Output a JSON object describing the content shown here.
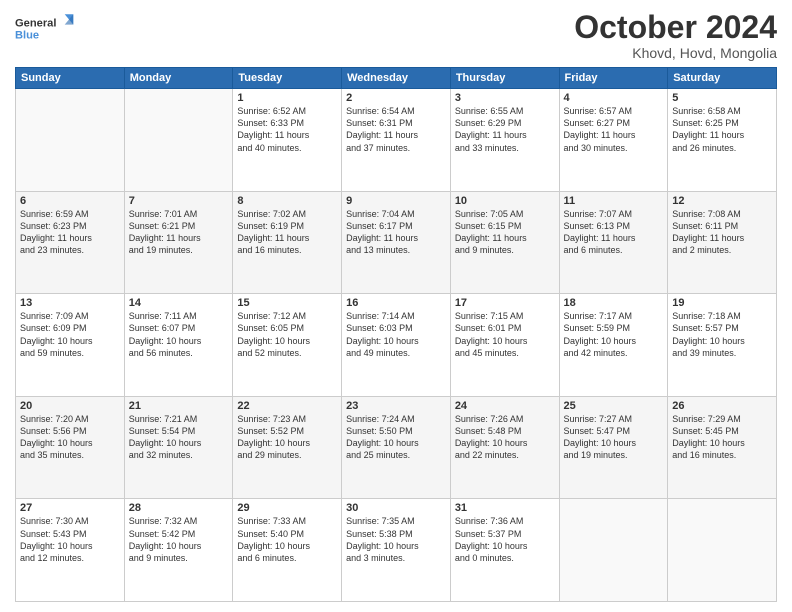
{
  "logo": {
    "line1": "General",
    "line2": "Blue"
  },
  "title": "October 2024",
  "location": "Khovd, Hovd, Mongolia",
  "weekdays": [
    "Sunday",
    "Monday",
    "Tuesday",
    "Wednesday",
    "Thursday",
    "Friday",
    "Saturday"
  ],
  "weeks": [
    [
      {
        "day": "",
        "info": ""
      },
      {
        "day": "",
        "info": ""
      },
      {
        "day": "1",
        "info": "Sunrise: 6:52 AM\nSunset: 6:33 PM\nDaylight: 11 hours\nand 40 minutes."
      },
      {
        "day": "2",
        "info": "Sunrise: 6:54 AM\nSunset: 6:31 PM\nDaylight: 11 hours\nand 37 minutes."
      },
      {
        "day": "3",
        "info": "Sunrise: 6:55 AM\nSunset: 6:29 PM\nDaylight: 11 hours\nand 33 minutes."
      },
      {
        "day": "4",
        "info": "Sunrise: 6:57 AM\nSunset: 6:27 PM\nDaylight: 11 hours\nand 30 minutes."
      },
      {
        "day": "5",
        "info": "Sunrise: 6:58 AM\nSunset: 6:25 PM\nDaylight: 11 hours\nand 26 minutes."
      }
    ],
    [
      {
        "day": "6",
        "info": "Sunrise: 6:59 AM\nSunset: 6:23 PM\nDaylight: 11 hours\nand 23 minutes."
      },
      {
        "day": "7",
        "info": "Sunrise: 7:01 AM\nSunset: 6:21 PM\nDaylight: 11 hours\nand 19 minutes."
      },
      {
        "day": "8",
        "info": "Sunrise: 7:02 AM\nSunset: 6:19 PM\nDaylight: 11 hours\nand 16 minutes."
      },
      {
        "day": "9",
        "info": "Sunrise: 7:04 AM\nSunset: 6:17 PM\nDaylight: 11 hours\nand 13 minutes."
      },
      {
        "day": "10",
        "info": "Sunrise: 7:05 AM\nSunset: 6:15 PM\nDaylight: 11 hours\nand 9 minutes."
      },
      {
        "day": "11",
        "info": "Sunrise: 7:07 AM\nSunset: 6:13 PM\nDaylight: 11 hours\nand 6 minutes."
      },
      {
        "day": "12",
        "info": "Sunrise: 7:08 AM\nSunset: 6:11 PM\nDaylight: 11 hours\nand 2 minutes."
      }
    ],
    [
      {
        "day": "13",
        "info": "Sunrise: 7:09 AM\nSunset: 6:09 PM\nDaylight: 10 hours\nand 59 minutes."
      },
      {
        "day": "14",
        "info": "Sunrise: 7:11 AM\nSunset: 6:07 PM\nDaylight: 10 hours\nand 56 minutes."
      },
      {
        "day": "15",
        "info": "Sunrise: 7:12 AM\nSunset: 6:05 PM\nDaylight: 10 hours\nand 52 minutes."
      },
      {
        "day": "16",
        "info": "Sunrise: 7:14 AM\nSunset: 6:03 PM\nDaylight: 10 hours\nand 49 minutes."
      },
      {
        "day": "17",
        "info": "Sunrise: 7:15 AM\nSunset: 6:01 PM\nDaylight: 10 hours\nand 45 minutes."
      },
      {
        "day": "18",
        "info": "Sunrise: 7:17 AM\nSunset: 5:59 PM\nDaylight: 10 hours\nand 42 minutes."
      },
      {
        "day": "19",
        "info": "Sunrise: 7:18 AM\nSunset: 5:57 PM\nDaylight: 10 hours\nand 39 minutes."
      }
    ],
    [
      {
        "day": "20",
        "info": "Sunrise: 7:20 AM\nSunset: 5:56 PM\nDaylight: 10 hours\nand 35 minutes."
      },
      {
        "day": "21",
        "info": "Sunrise: 7:21 AM\nSunset: 5:54 PM\nDaylight: 10 hours\nand 32 minutes."
      },
      {
        "day": "22",
        "info": "Sunrise: 7:23 AM\nSunset: 5:52 PM\nDaylight: 10 hours\nand 29 minutes."
      },
      {
        "day": "23",
        "info": "Sunrise: 7:24 AM\nSunset: 5:50 PM\nDaylight: 10 hours\nand 25 minutes."
      },
      {
        "day": "24",
        "info": "Sunrise: 7:26 AM\nSunset: 5:48 PM\nDaylight: 10 hours\nand 22 minutes."
      },
      {
        "day": "25",
        "info": "Sunrise: 7:27 AM\nSunset: 5:47 PM\nDaylight: 10 hours\nand 19 minutes."
      },
      {
        "day": "26",
        "info": "Sunrise: 7:29 AM\nSunset: 5:45 PM\nDaylight: 10 hours\nand 16 minutes."
      }
    ],
    [
      {
        "day": "27",
        "info": "Sunrise: 7:30 AM\nSunset: 5:43 PM\nDaylight: 10 hours\nand 12 minutes."
      },
      {
        "day": "28",
        "info": "Sunrise: 7:32 AM\nSunset: 5:42 PM\nDaylight: 10 hours\nand 9 minutes."
      },
      {
        "day": "29",
        "info": "Sunrise: 7:33 AM\nSunset: 5:40 PM\nDaylight: 10 hours\nand 6 minutes."
      },
      {
        "day": "30",
        "info": "Sunrise: 7:35 AM\nSunset: 5:38 PM\nDaylight: 10 hours\nand 3 minutes."
      },
      {
        "day": "31",
        "info": "Sunrise: 7:36 AM\nSunset: 5:37 PM\nDaylight: 10 hours\nand 0 minutes."
      },
      {
        "day": "",
        "info": ""
      },
      {
        "day": "",
        "info": ""
      }
    ]
  ]
}
